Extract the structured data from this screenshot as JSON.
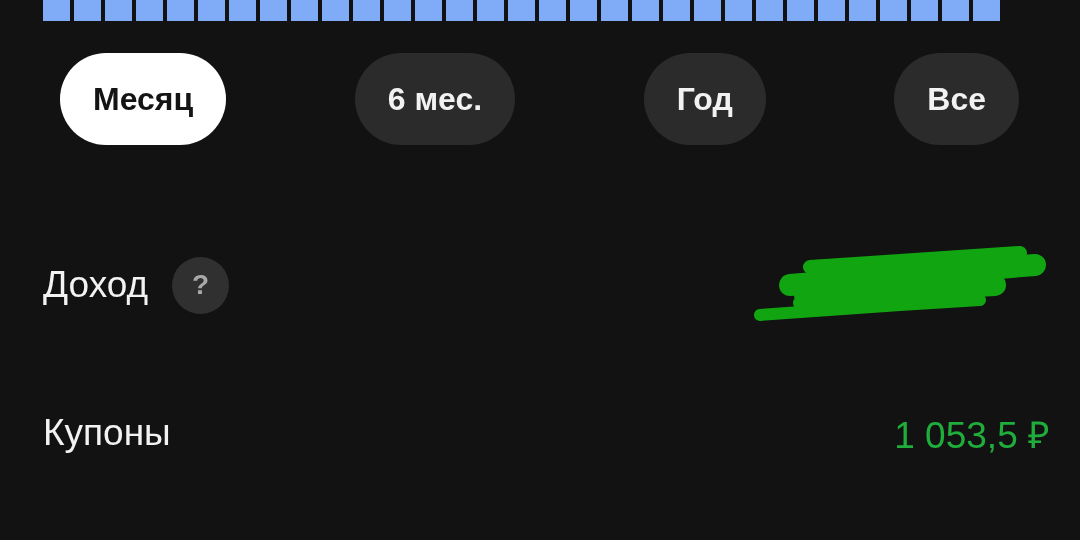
{
  "tabs": [
    {
      "label": "Месяц",
      "selected": true
    },
    {
      "label": "6 мес.",
      "selected": false
    },
    {
      "label": "Год",
      "selected": false
    },
    {
      "label": "Все",
      "selected": false
    }
  ],
  "rows": [
    {
      "label": "Доход",
      "help": "?",
      "redacted": true
    },
    {
      "label": "Купоны",
      "value": "1 053,5 ₽",
      "redacted": false
    }
  ]
}
